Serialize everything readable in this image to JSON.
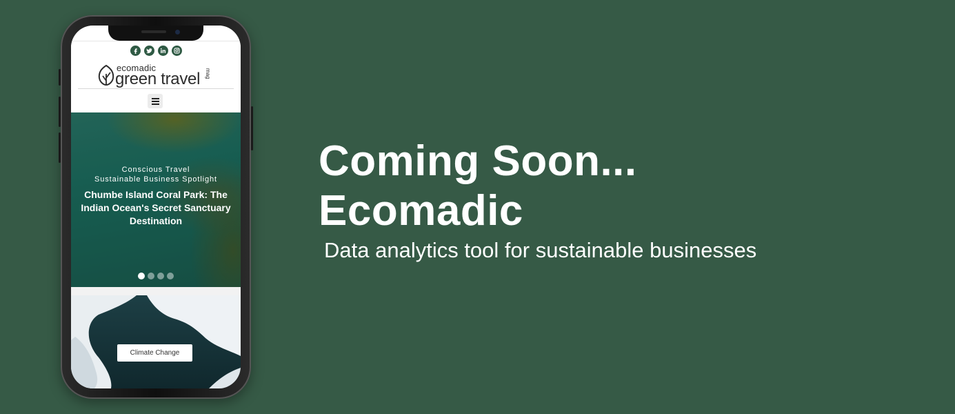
{
  "banner": {
    "headline_line1": "Coming Soon...",
    "headline_line2": "Ecomadic",
    "tagline": "Data analytics tool for sustainable businesses",
    "background_color": "#365a46"
  },
  "phone_site": {
    "social_icons": [
      "facebook-icon",
      "twitter-icon",
      "linkedin-icon",
      "instagram-icon"
    ],
    "logo": {
      "small_text": "ecomadic",
      "big_text": "green travel",
      "side_text": "mag"
    },
    "menu_icon": "hamburger-menu-icon",
    "hero": {
      "kicker_1": "Conscious Travel",
      "kicker_2": "Sustainable Business Spotlight",
      "title": "Chumbe Island Coral Park: The Indian Ocean's Secret Sanctuary Destination",
      "slide_count": 4,
      "active_slide": 1
    },
    "card2": {
      "button_label": "Climate Change"
    },
    "brand_color": "#2f5a44"
  }
}
